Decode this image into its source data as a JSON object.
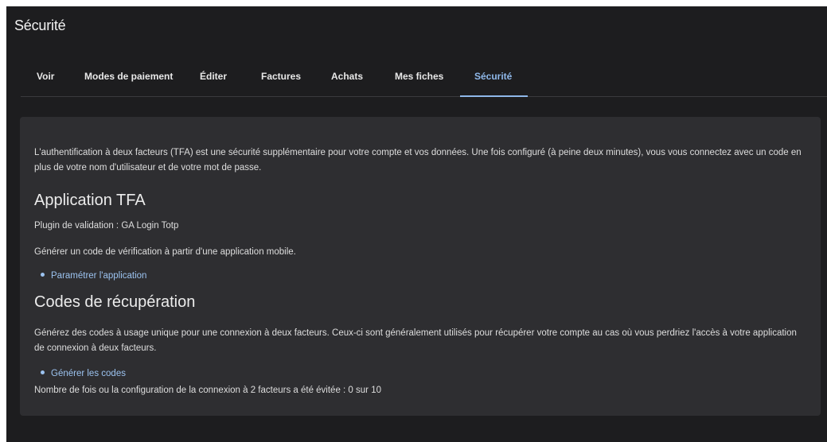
{
  "header": {
    "title": "Sécurité"
  },
  "tabs": [
    {
      "label": "Voir"
    },
    {
      "label": "Modes de paiement"
    },
    {
      "label": "Éditer"
    },
    {
      "label": "Factures"
    },
    {
      "label": "Achats"
    },
    {
      "label": "Mes fiches"
    },
    {
      "label": "Sécurité",
      "active": true
    }
  ],
  "content": {
    "intro": "L'authentification à deux facteurs (TFA) est une sécurité supplémentaire pour votre compte et vos données. Une fois configuré (à peine deux minutes), vous vous connectez avec un code en plus de votre nom d'utilisateur et de votre mot de passe.",
    "tfa_app": {
      "heading": "Application TFA",
      "plugin": "Plugin de validation : GA Login Totp",
      "description": "Générer un code de vérification à partir d'une application mobile.",
      "link": "Paramétrer l'application"
    },
    "recovery": {
      "heading": "Codes de récupération",
      "description": "Générez des codes à usage unique pour une connexion à deux facteurs. Ceux-ci sont généralement utilisés pour récupérer votre compte au cas où vous perdriez l'accès à votre application de connexion à deux facteurs.",
      "link": "Générer les codes",
      "skip_count": "Nombre de fois ou la configuration de la connexion à 2 facteurs a été évitée : 0 sur 10"
    }
  },
  "colors": {
    "background": "#1d1d1f",
    "card": "#2e2e31",
    "accent": "#8fb8ea"
  }
}
